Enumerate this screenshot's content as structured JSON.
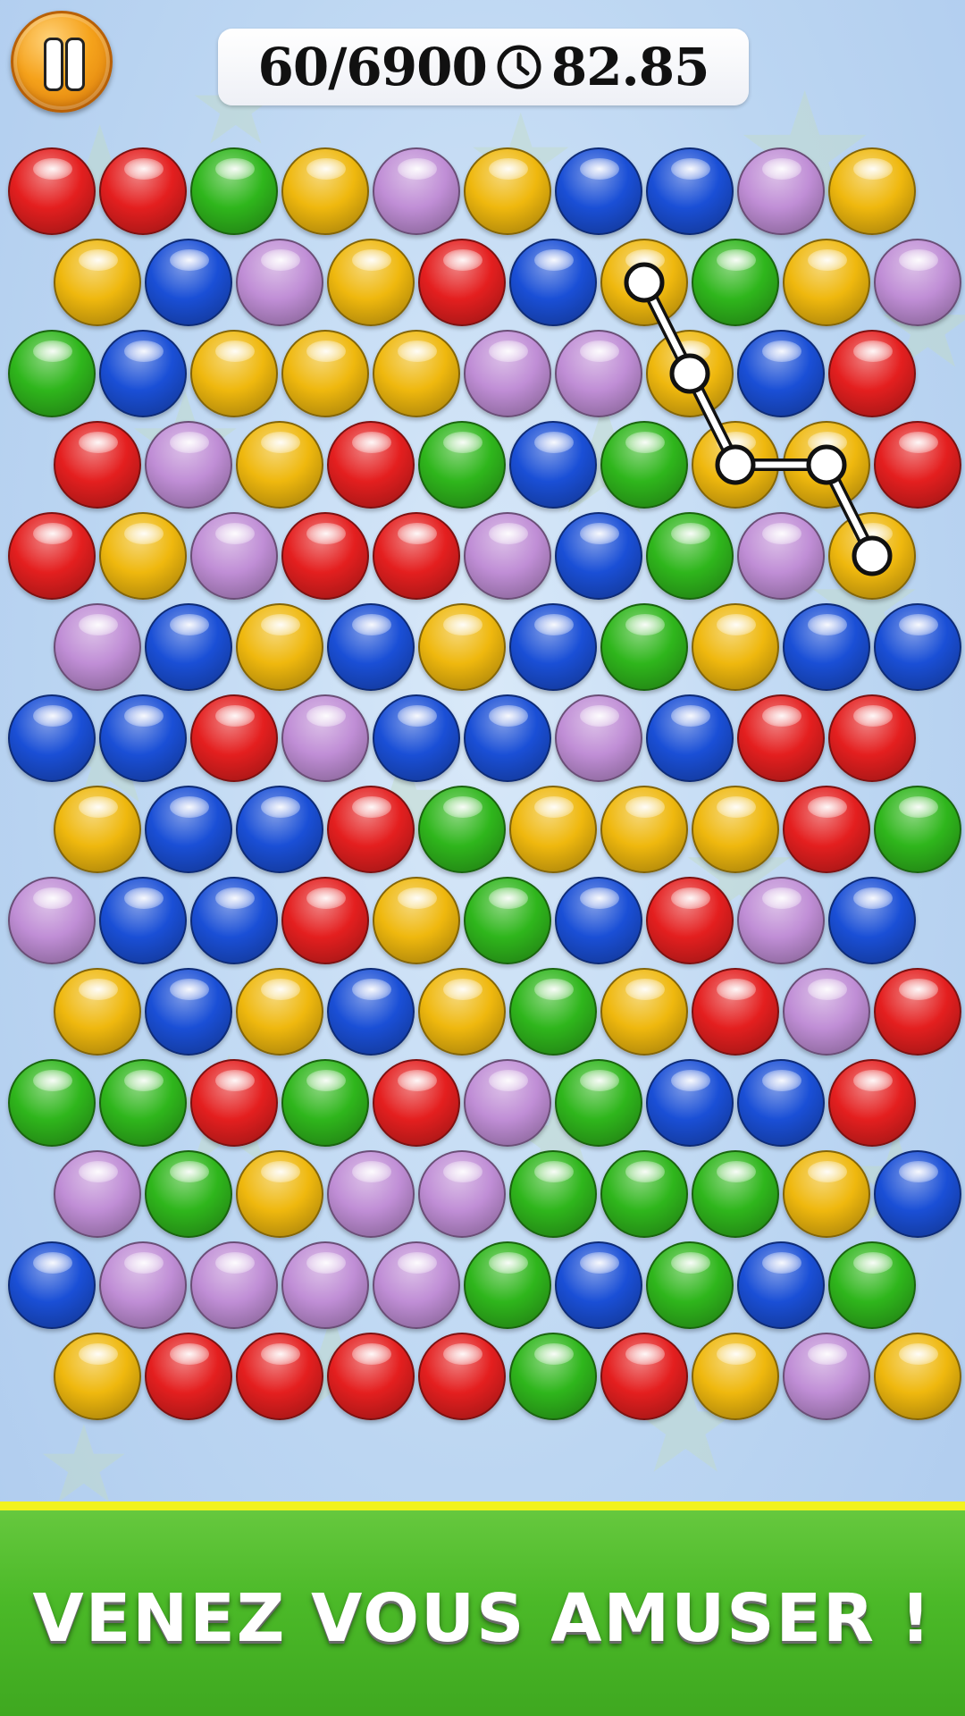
{
  "hud": {
    "score": "60/6900",
    "time": "82.85",
    "pause_icon": "pause-icon",
    "clock_icon": "clock-icon"
  },
  "board": {
    "rows": [
      [
        "red",
        "red",
        "green",
        "yellow",
        "purple",
        "yellow",
        "blue",
        "blue",
        "purple",
        "yellow"
      ],
      [
        "yellow",
        "blue",
        "purple",
        "yellow",
        "red",
        "blue",
        "yellow",
        "green",
        "yellow",
        "purple"
      ],
      [
        "green",
        "blue",
        "yellow",
        "yellow",
        "yellow",
        "purple",
        "purple",
        "yellow",
        "blue",
        "red"
      ],
      [
        "red",
        "purple",
        "yellow",
        "red",
        "green",
        "blue",
        "green",
        "yellow",
        "yellow",
        "red"
      ],
      [
        "red",
        "yellow",
        "purple",
        "red",
        "red",
        "purple",
        "blue",
        "green",
        "purple",
        "yellow"
      ],
      [
        "purple",
        "blue",
        "yellow",
        "blue",
        "yellow",
        "blue",
        "green",
        "yellow",
        "blue",
        "blue"
      ],
      [
        "blue",
        "blue",
        "red",
        "purple",
        "blue",
        "blue",
        "purple",
        "blue",
        "red",
        "red"
      ],
      [
        "yellow",
        "blue",
        "blue",
        "red",
        "green",
        "yellow",
        "yellow",
        "yellow",
        "red",
        "green"
      ],
      [
        "purple",
        "blue",
        "blue",
        "red",
        "yellow",
        "green",
        "blue",
        "red",
        "purple",
        "blue"
      ],
      [
        "yellow",
        "blue",
        "yellow",
        "blue",
        "yellow",
        "green",
        "yellow",
        "red",
        "purple",
        "red"
      ],
      [
        "green",
        "green",
        "red",
        "green",
        "red",
        "purple",
        "green",
        "blue",
        "blue",
        "red"
      ],
      [
        "purple",
        "green",
        "yellow",
        "purple",
        "purple",
        "green",
        "green",
        "green",
        "yellow",
        "blue"
      ],
      [
        "blue",
        "purple",
        "purple",
        "purple",
        "purple",
        "green",
        "blue",
        "green",
        "blue",
        "green"
      ],
      [
        "yellow",
        "red",
        "red",
        "red",
        "red",
        "green",
        "red",
        "yellow",
        "purple",
        "yellow"
      ]
    ],
    "selected_path": [
      [
        1,
        6
      ],
      [
        2,
        7
      ],
      [
        3,
        7
      ],
      [
        3,
        8
      ],
      [
        4,
        9
      ]
    ]
  },
  "colors": {
    "red": "#e41f1f",
    "green": "#2fb61c",
    "yellow": "#efb80e",
    "blue": "#1a4fd6",
    "purple": "#c08ed6"
  },
  "banner": {
    "text": "VENEZ VOUS AMUSER !"
  }
}
